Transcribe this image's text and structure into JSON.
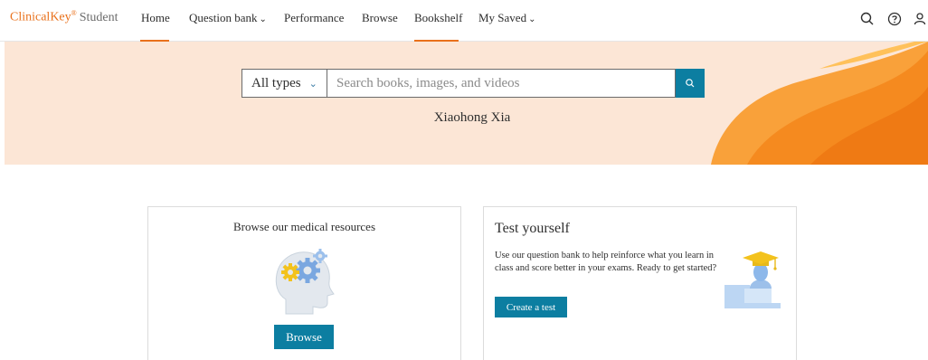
{
  "nav": {
    "brand": {
      "name": "ClinicalKey",
      "mark": "®",
      "sub": "Student"
    },
    "items": [
      {
        "label": "Home",
        "active": true,
        "dropdown": false
      },
      {
        "label": "Question bank",
        "active": false,
        "dropdown": true
      },
      {
        "label": "Performance",
        "active": false,
        "dropdown": false
      },
      {
        "label": "Browse",
        "active": false,
        "dropdown": false
      },
      {
        "label": "Bookshelf",
        "active": true,
        "dropdown": false
      },
      {
        "label": "My Saved",
        "active": false,
        "dropdown": true
      }
    ],
    "tools": [
      "search-icon",
      "help-icon",
      "user-icon"
    ]
  },
  "hero": {
    "type_select": "All types",
    "search_placeholder": "Search books, images, and videos",
    "user_name": "Xiaohong Xia"
  },
  "cards": {
    "browse": {
      "title": "Browse our medical resources",
      "button": "Browse",
      "illustration": "head-gears-icon"
    },
    "test": {
      "title": "Test yourself",
      "description": "Use our question bank to help reinforce what you learn in class and score better in your exams. Ready to get started?",
      "button": "Create a test",
      "illustration": "graduate-icon"
    }
  },
  "colors": {
    "accent": "#e9711c",
    "primary_button": "#0c7ea1",
    "hero_bg": "#fce6d6",
    "wave_light": "#ffc15a",
    "wave_dark": "#f58a1f"
  }
}
